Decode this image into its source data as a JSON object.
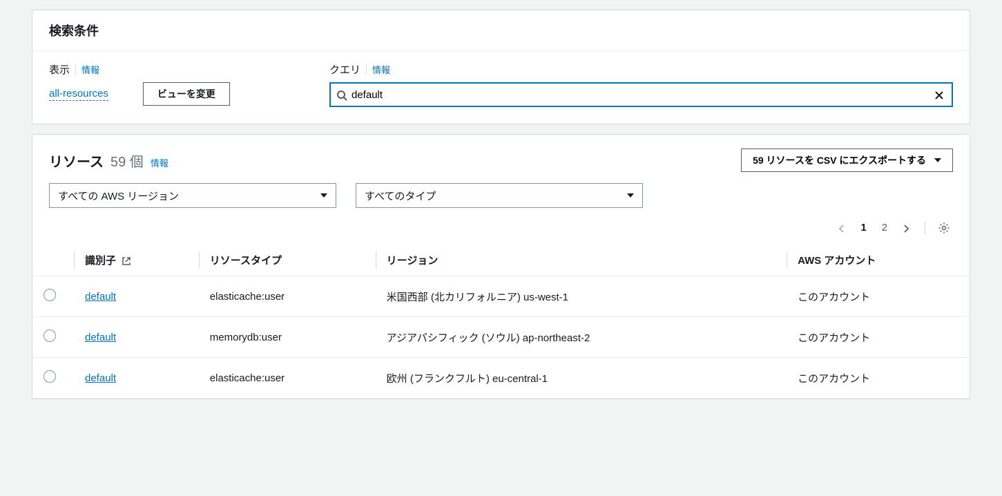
{
  "searchCriteria": {
    "title": "検索条件",
    "viewLabel": "表示",
    "info": "情報",
    "viewLink": "all-resources",
    "changeViewBtn": "ビューを変更",
    "queryLabel": "クエリ",
    "queryValue": "default"
  },
  "resources": {
    "title": "リソース",
    "count": "59 個",
    "info": "情報",
    "exportBtn": "59 リソースを CSV にエクスポートする",
    "filterRegion": "すべての AWS リージョン",
    "filterType": "すべてのタイプ",
    "page1": "1",
    "page2": "2"
  },
  "columns": {
    "id": "識別子",
    "type": "リソースタイプ",
    "region": "リージョン",
    "account": "AWS アカウント"
  },
  "rows": [
    {
      "id": "default",
      "type": "elasticache:user",
      "region": "米国西部 (北カリフォルニア) us-west-1",
      "account": "このアカウント"
    },
    {
      "id": "default",
      "type": "memorydb:user",
      "region": "アジアパシフィック (ソウル) ap-northeast-2",
      "account": "このアカウント"
    },
    {
      "id": "default",
      "type": "elasticache:user",
      "region": "欧州 (フランクフルト) eu-central-1",
      "account": "このアカウント"
    }
  ]
}
